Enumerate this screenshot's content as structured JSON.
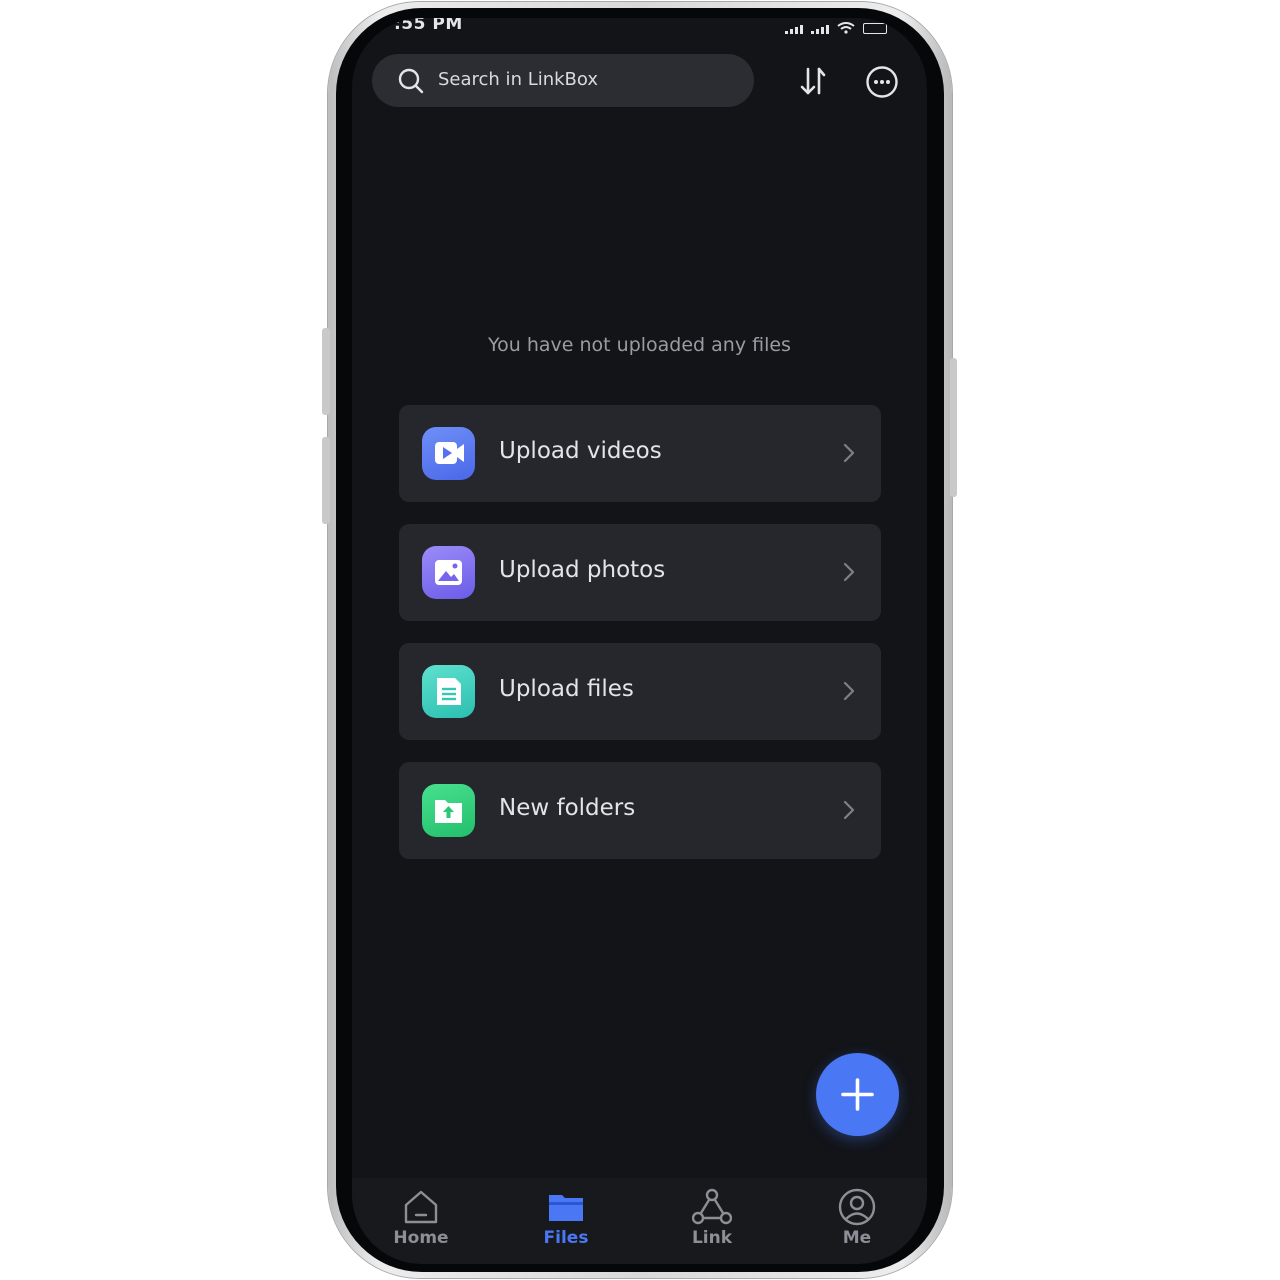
{
  "status_bar": {
    "time": ":55 PM"
  },
  "header": {
    "search_placeholder": "Search in LinkBox",
    "sort_icon": "sort-arrows-icon",
    "more_icon": "more-options-icon"
  },
  "main": {
    "empty_message": "You have not uploaded any files",
    "actions": [
      {
        "label": "Upload videos",
        "icon": "video-icon",
        "color": "#5b7cf0"
      },
      {
        "label": "Upload photos",
        "icon": "photo-icon",
        "color": "#7a6cf0"
      },
      {
        "label": "Upload files",
        "icon": "document-icon",
        "color": "#3cd0c0"
      },
      {
        "label": "New folders",
        "icon": "folder-upload-icon",
        "color": "#2fcf7e"
      }
    ],
    "fab_icon": "plus-icon"
  },
  "bottom_nav": {
    "items": [
      {
        "label": "Home",
        "icon": "home-icon"
      },
      {
        "label": "Files",
        "icon": "folder-icon"
      },
      {
        "label": "Link",
        "icon": "link-nodes-icon"
      },
      {
        "label": "Me",
        "icon": "user-icon"
      }
    ],
    "active": "Files"
  },
  "colors": {
    "accent": "#4a78f5",
    "background": "#121418",
    "card": "#25272c",
    "inactive_nav": "#8c8f96"
  }
}
